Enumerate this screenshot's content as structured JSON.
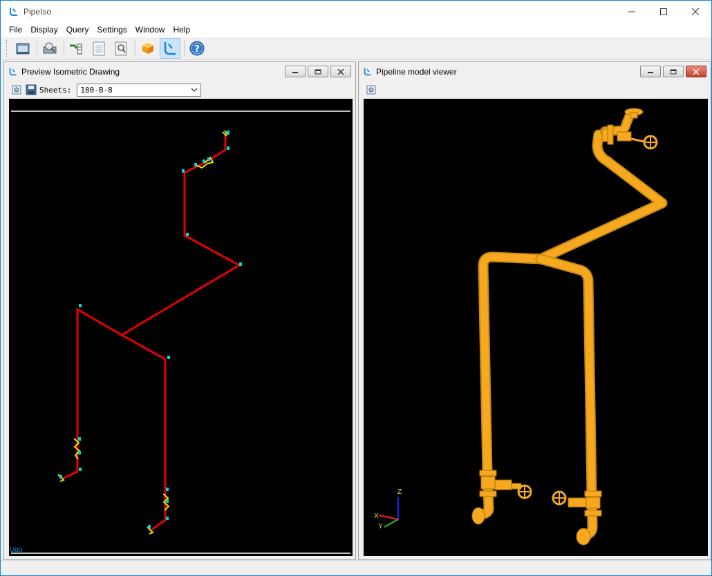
{
  "app": {
    "title": "PipeIso"
  },
  "window_controls": {
    "minimize": "—",
    "maximize": "☐",
    "close": "✕"
  },
  "menu": [
    "File",
    "Display",
    "Query",
    "Settings",
    "Window",
    "Help"
  ],
  "toolbar": {
    "buttons": [
      "open-icon",
      "print-preview-icon",
      "pipe-route-icon",
      "document-icon",
      "zoom-page-icon",
      "box-model-icon",
      "pipeiso-icon",
      "help-icon"
    ]
  },
  "iso_panel": {
    "title": "Preview Isometric Drawing",
    "sheets_label": "Sheets:",
    "sheet_value": "100-B-8",
    "corner_text": "Ugo"
  },
  "model_panel": {
    "title": "Pipeline model viewer",
    "axes": {
      "x": "X",
      "y": "Y",
      "z": "Z"
    }
  },
  "colors": {
    "accent": "#1883d7",
    "pipe_iso": "#e60000",
    "pipe_model": "#f5a820",
    "fitting_marker": "#00d8d8",
    "fitting_symbol": "#e8e800",
    "canvas_bg": "#000000"
  }
}
